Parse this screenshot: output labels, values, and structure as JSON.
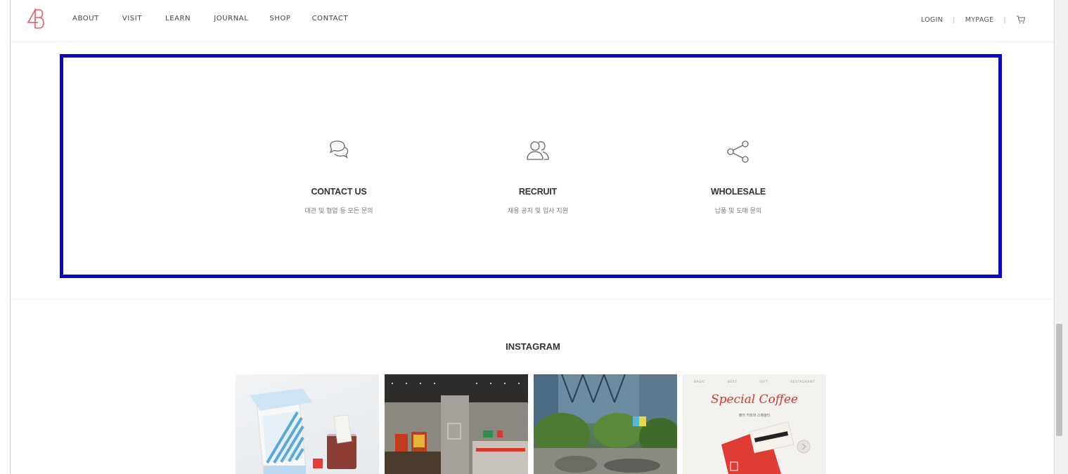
{
  "header": {
    "nav": [
      "ABOUT",
      "VISIT",
      "LEARN",
      "JOURNAL",
      "SHOP",
      "CONTACT"
    ],
    "login_label": "LOGIN",
    "mypage_label": "MYPAGE",
    "separator": "|",
    "cart_icon": "cart-icon"
  },
  "contact": {
    "cards": [
      {
        "icon": "chat-bubbles-icon",
        "title": "CONTACT US",
        "subtitle": "대관 및 협업 등 모든 문의"
      },
      {
        "icon": "people-icon",
        "title": "RECRUIT",
        "subtitle": "채용 공지 및 입사 지원"
      },
      {
        "icon": "share-icon",
        "title": "WHOLESALE",
        "subtitle": "납품 및 도매 문의"
      }
    ],
    "highlight_color": "#0a08c4"
  },
  "instagram": {
    "title": "INSTAGRAM",
    "tile4_menu": [
      "BASIC",
      "BEST",
      "GIFT",
      "RESTAURANT"
    ],
    "tile4_heading": "Special Coffee",
    "tile4_caption": "페어 커피와 스페셜티"
  },
  "colors": {
    "logo": "#e85a6a"
  }
}
